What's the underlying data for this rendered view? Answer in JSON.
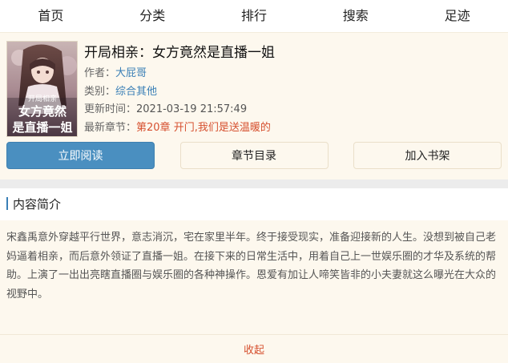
{
  "nav": {
    "items": [
      {
        "label": "首页"
      },
      {
        "label": "分类"
      },
      {
        "label": "排行"
      },
      {
        "label": "搜索"
      },
      {
        "label": "足迹"
      }
    ]
  },
  "book": {
    "title": "开局相亲：女方竟然是直播一姐",
    "cover_text": "开局相亲 女方竟然是直播一姐",
    "author_label": "作者：",
    "author": "大屁哥",
    "category_label": "类别：",
    "category": "综合其他",
    "updated_label": "更新时间：",
    "updated": "2021-03-19 21:57:49",
    "latest_label": "最新章节：",
    "latest": "第20章 开门,我们是送温暖的"
  },
  "actions": {
    "read": "立即阅读",
    "catalog": "章节目录",
    "shelf": "加入书架"
  },
  "intro": {
    "heading": "内容简介",
    "text": "宋鑫禹意外穿越平行世界，意志消沉，宅在家里半年。终于接受现实，准备迎接新的人生。没想到被自己老妈逼着相亲，而后意外领证了直播一姐。在接下来的日常生活中，用着自己上一世娱乐圈的才华及系统的帮助。上演了一出出亮瞎直播圈与娱乐圈的各种神操作。恩爱有加让人啼笑皆非的小夫妻就这么曝光在大众的视野中。",
    "collapse": "收起"
  },
  "colors": {
    "accent": "#4a8fc0",
    "link": "#3a7fb6",
    "highlight": "#d6502f",
    "panel": "#fdf8ee"
  }
}
